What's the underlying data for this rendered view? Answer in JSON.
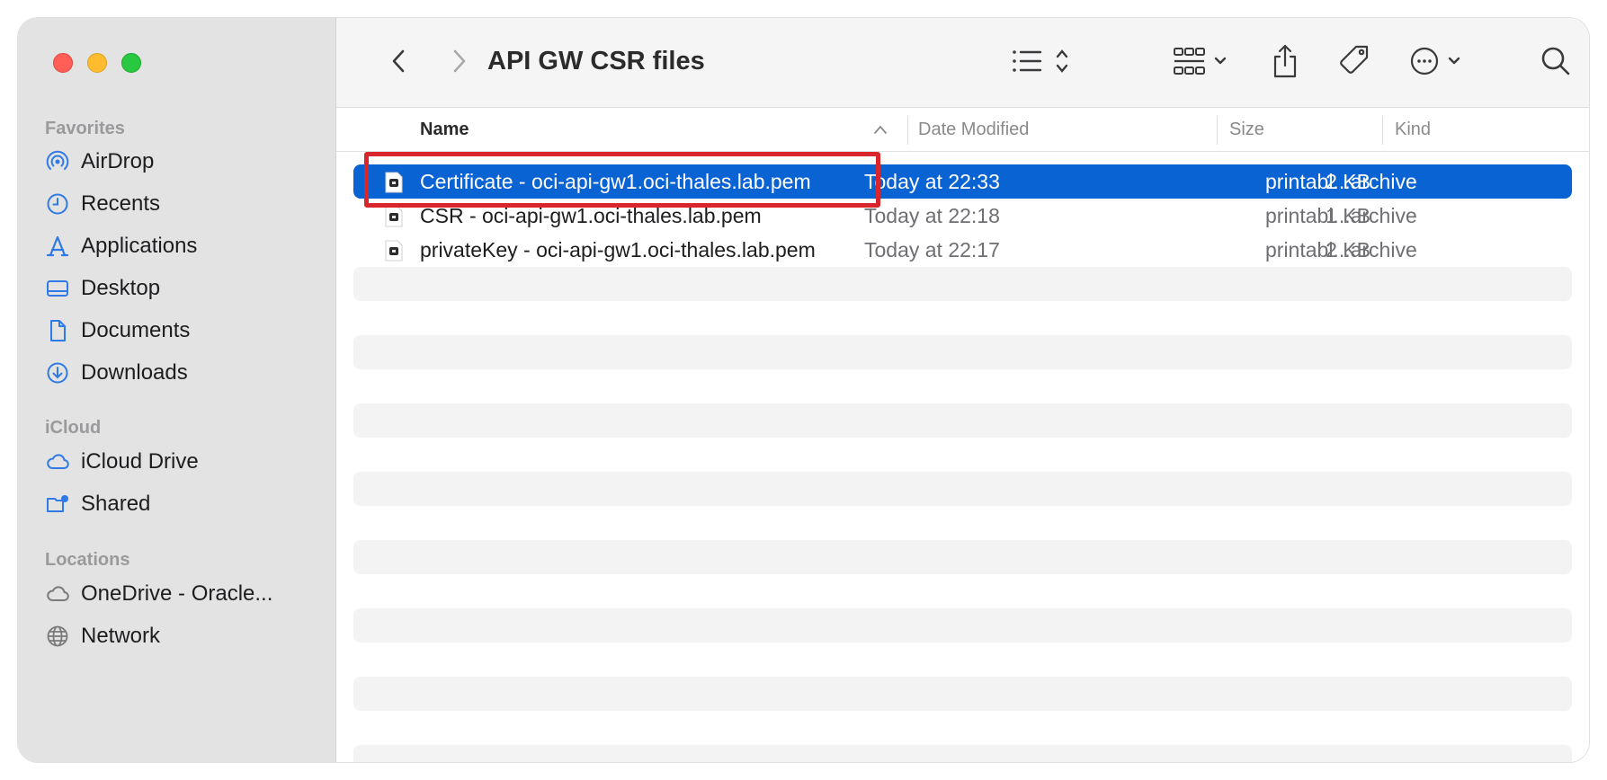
{
  "window": {
    "title": "API GW CSR files"
  },
  "sidebar": {
    "sections": [
      {
        "label": "Favorites",
        "items": [
          {
            "label": "AirDrop",
            "icon": "airdrop-icon"
          },
          {
            "label": "Recents",
            "icon": "clock-icon"
          },
          {
            "label": "Applications",
            "icon": "applications-icon"
          },
          {
            "label": "Desktop",
            "icon": "desktop-icon"
          },
          {
            "label": "Documents",
            "icon": "document-icon"
          },
          {
            "label": "Downloads",
            "icon": "download-icon"
          }
        ]
      },
      {
        "label": "iCloud",
        "items": [
          {
            "label": "iCloud Drive",
            "icon": "cloud-icon"
          },
          {
            "label": "Shared",
            "icon": "shared-folder-icon"
          }
        ]
      },
      {
        "label": "Locations",
        "items": [
          {
            "label": "OneDrive - Oracle...",
            "icon": "cloud-outline-icon"
          },
          {
            "label": "Network",
            "icon": "globe-icon"
          }
        ]
      }
    ]
  },
  "columns": {
    "name": "Name",
    "date": "Date Modified",
    "size": "Size",
    "kind": "Kind"
  },
  "files": [
    {
      "name": "Certificate - oci-api-gw1.oci-thales.lab.pem",
      "date": "Today at 22:33",
      "size": "2 KB",
      "kind": "printabl...archive",
      "selected": true
    },
    {
      "name": "CSR - oci-api-gw1.oci-thales.lab.pem",
      "date": "Today at 22:18",
      "size": "1 KB",
      "kind": "printabl...archive",
      "selected": false
    },
    {
      "name": "privateKey - oci-api-gw1.oci-thales.lab.pem",
      "date": "Today at 22:17",
      "size": "2 KB",
      "kind": "printabl...archive",
      "selected": false
    }
  ],
  "colors": {
    "selection": "#0a63d3",
    "highlight_box": "#d9262d",
    "sidebar_bg": "#e4e3e4",
    "accent_icon": "#2f7ae5"
  }
}
